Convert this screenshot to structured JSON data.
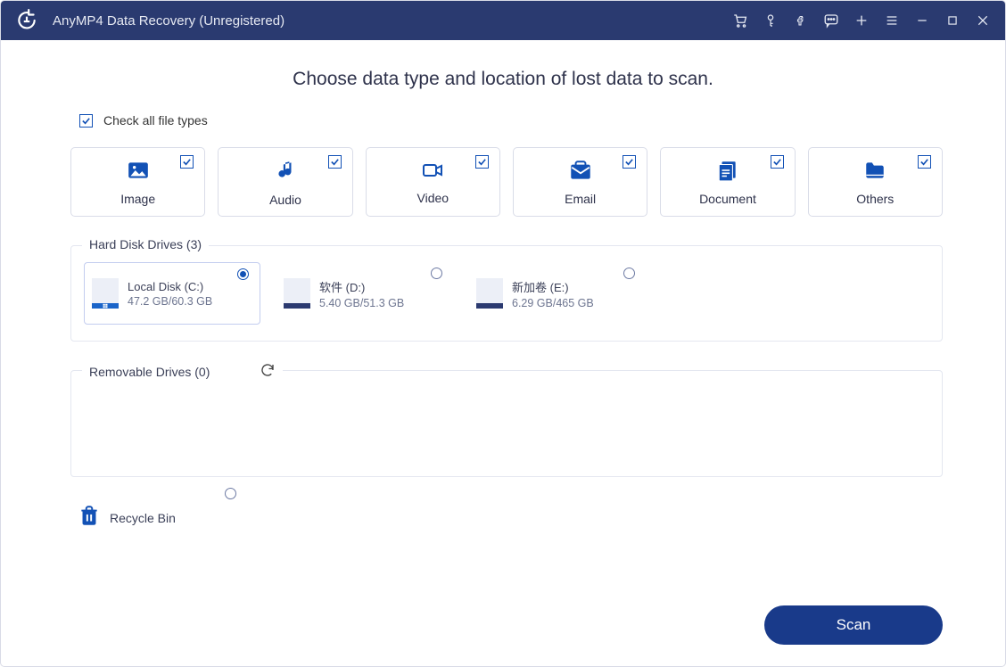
{
  "titlebar": {
    "title": "AnyMP4 Data Recovery (Unregistered)"
  },
  "heading": "Choose data type and location of lost data to scan.",
  "check_all": {
    "label": "Check all file types",
    "checked": true
  },
  "file_types": [
    {
      "label": "Image",
      "checked": true,
      "key": "image"
    },
    {
      "label": "Audio",
      "checked": true,
      "key": "audio"
    },
    {
      "label": "Video",
      "checked": true,
      "key": "video"
    },
    {
      "label": "Email",
      "checked": true,
      "key": "email"
    },
    {
      "label": "Document",
      "checked": true,
      "key": "document"
    },
    {
      "label": "Others",
      "checked": true,
      "key": "others"
    }
  ],
  "hdd": {
    "legend": "Hard Disk Drives (3)",
    "items": [
      {
        "name": "Local Disk (C:)",
        "size": "47.2 GB/60.3 GB",
        "selected": true,
        "win": true
      },
      {
        "name": "软件 (D:)",
        "size": "5.40 GB/51.3 GB",
        "selected": false,
        "win": false
      },
      {
        "name": "新加卷 (E:)",
        "size": "6.29 GB/465 GB",
        "selected": false,
        "win": false
      }
    ]
  },
  "removable": {
    "legend": "Removable Drives (0)"
  },
  "recycle": {
    "label": "Recycle Bin",
    "selected": false
  },
  "scan_label": "Scan"
}
